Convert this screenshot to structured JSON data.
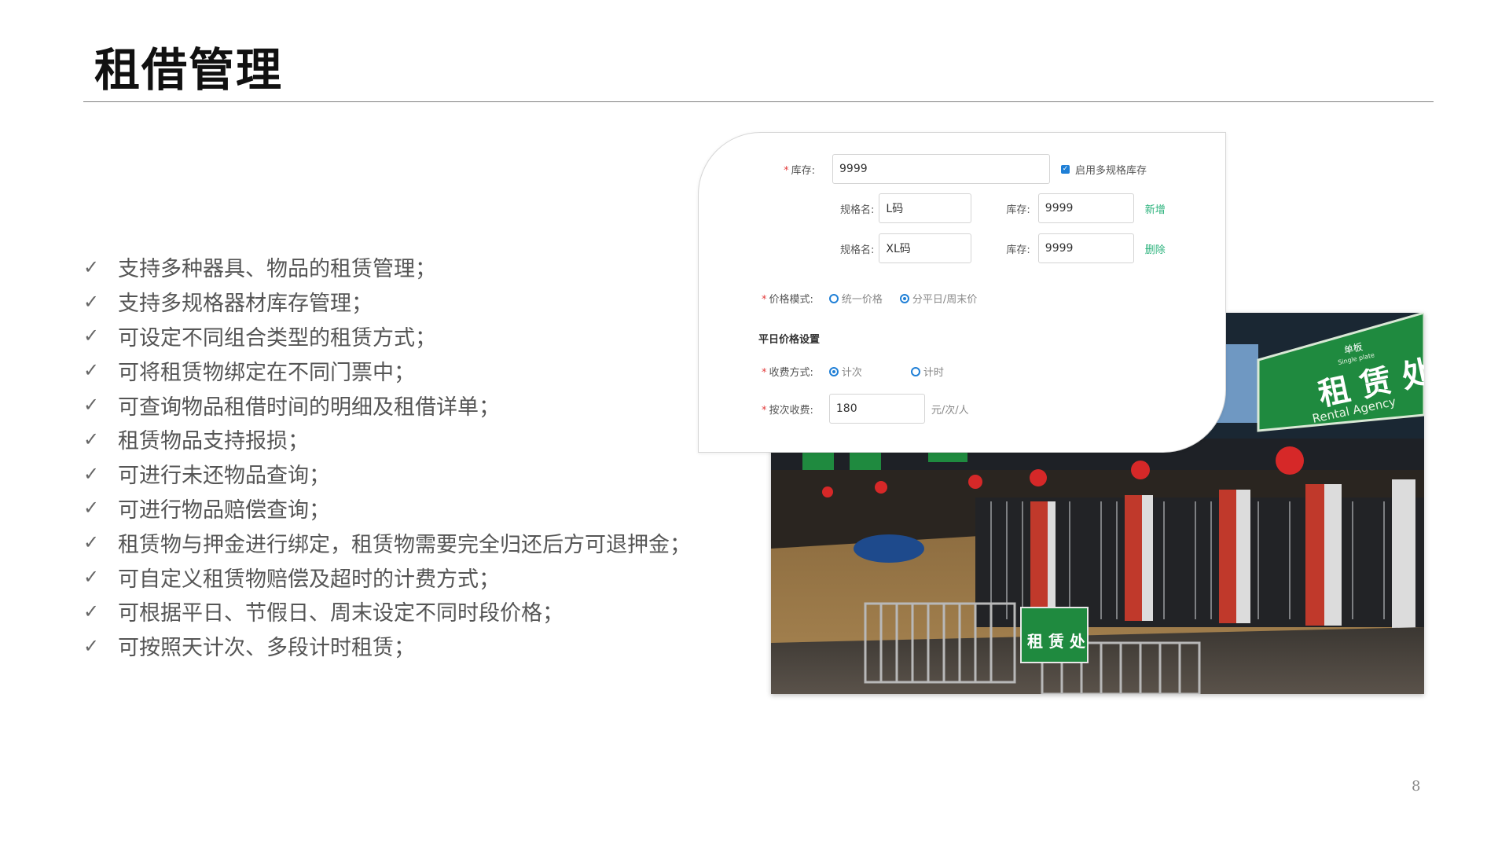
{
  "slide": {
    "title": "租借管理",
    "page_number": "8"
  },
  "features": [
    "支持多种器具、物品的租赁管理；",
    "支持多规格器材库存管理；",
    "可设定不同组合类型的租赁方式；",
    "可将租赁物绑定在不同门票中；",
    "可查询物品租借时间的明细及租借详单；",
    "租赁物品支持报损；",
    "可进行未还物品查询；",
    "可进行物品赔偿查询；",
    "租赁物与押金进行绑定，租赁物需要完全归还后方可退押金；",
    "可自定义租赁物赔偿及超时的计费方式；",
    "可根据平日、节假日、周末设定不同时段价格；",
    "可按照天计次、多段计时租赁；"
  ],
  "check_glyph": "✓",
  "form": {
    "required_mark": "*",
    "stock_label": "库存:",
    "stock_value": "9999",
    "multi_spec_checkbox_label": "启用多规格库存",
    "multi_spec_checked": true,
    "spec_rows": [
      {
        "name_label": "规格名:",
        "name_value": "L码",
        "stock_label": "库存:",
        "stock_value": "9999",
        "action": "新增"
      },
      {
        "name_label": "规格名:",
        "name_value": "XL码",
        "stock_label": "库存:",
        "stock_value": "9999",
        "action": "删除"
      }
    ],
    "price_mode_label": "价格模式:",
    "price_mode_options": [
      "统一价格",
      "分平日/周末价"
    ],
    "price_mode_selected": 1,
    "section_title": "平日价格设置",
    "charge_mode_label": "收费方式:",
    "charge_mode_options": [
      "计次",
      "计时"
    ],
    "charge_mode_selected": 0,
    "per_time_label": "按次收费:",
    "per_time_value": "180",
    "per_time_unit": "元/次/人",
    "accent_color": "#1f7fd6",
    "link_color": "#2ab27b"
  },
  "photo": {
    "sign_main": "租 赁 处",
    "sign_sub": "Rental Agency",
    "sign_top": "单板",
    "sign_top_sub": "Single plate",
    "sign_small": "租 赁 处"
  }
}
